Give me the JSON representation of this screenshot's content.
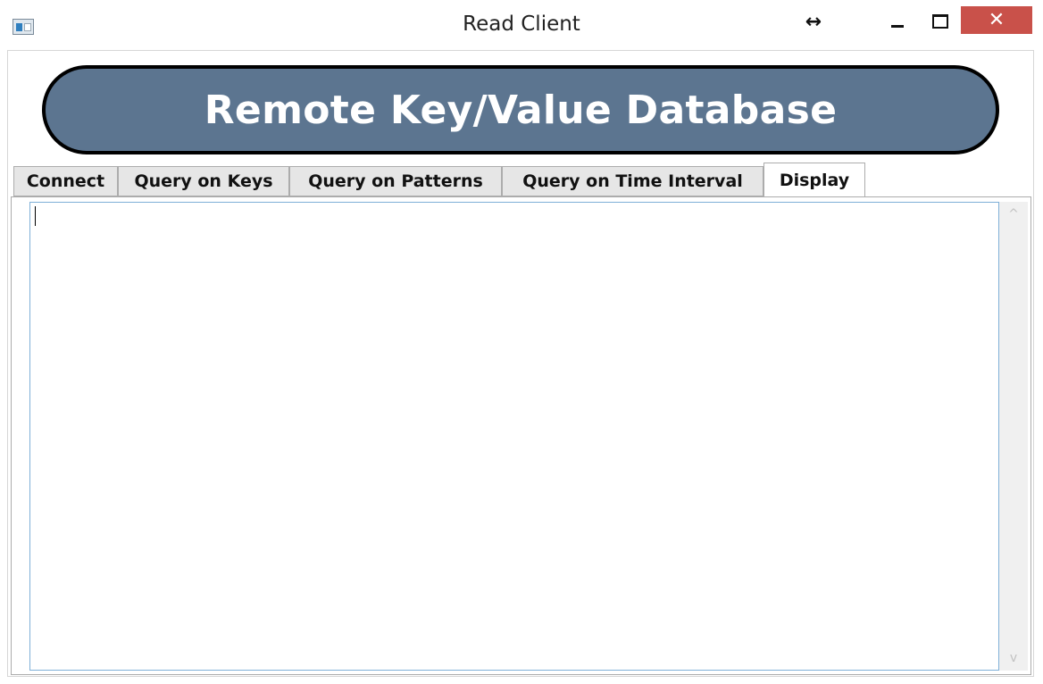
{
  "window": {
    "title": "Read Client",
    "icons": {
      "app": "window-app-icon",
      "resize": "horizontal-resize-icon",
      "minimize": "minimize-icon",
      "maximize": "maximize-icon",
      "close": "close-icon"
    },
    "resize_glyph": "↔",
    "close_glyph": "✕"
  },
  "banner": {
    "title": "Remote Key/Value Database",
    "color": "#5c7590"
  },
  "tabs": [
    {
      "label": "Connect",
      "selected": false
    },
    {
      "label": "Query on Keys",
      "selected": false
    },
    {
      "label": "Query on Patterns",
      "selected": false
    },
    {
      "label": "Query on Time Interval",
      "selected": false
    },
    {
      "label": "Display",
      "selected": true
    }
  ],
  "display": {
    "text": ""
  },
  "scrollbar": {
    "up_glyph": "^",
    "down_glyph": "v"
  },
  "colors": {
    "close_button": "#c9514a",
    "textarea_border": "#7fb0d8"
  }
}
